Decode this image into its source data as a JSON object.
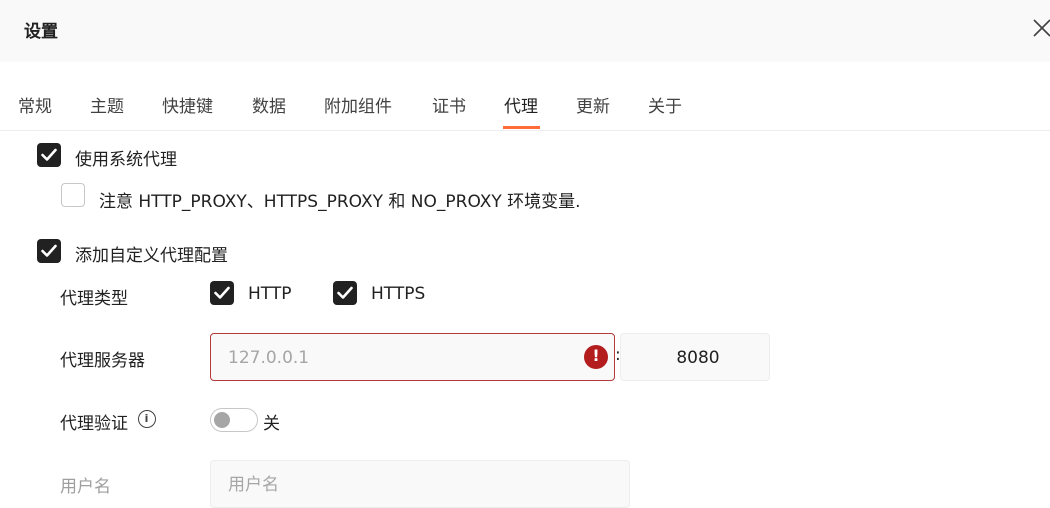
{
  "dialog": {
    "title": "设置"
  },
  "tabs": [
    {
      "label": "常规"
    },
    {
      "label": "主题"
    },
    {
      "label": "快捷键"
    },
    {
      "label": "数据"
    },
    {
      "label": "附加组件"
    },
    {
      "label": "证书"
    },
    {
      "label": "代理",
      "active": true
    },
    {
      "label": "更新"
    },
    {
      "label": "关于"
    }
  ],
  "proxy": {
    "use_system_proxy": {
      "label": "使用系统代理",
      "checked": true
    },
    "env_note": {
      "label": "注意 HTTP_PROXY、HTTPS_PROXY 和 NO_PROXY 环境变量.",
      "checked": false
    },
    "custom_proxy": {
      "label": "添加自定义代理配置",
      "checked": true
    },
    "proxy_type": {
      "label": "代理类型",
      "http": {
        "label": "HTTP",
        "checked": true
      },
      "https": {
        "label": "HTTPS",
        "checked": true
      }
    },
    "server": {
      "label": "代理服务器",
      "host_placeholder": "127.0.0.1",
      "host_value": "",
      "separator": ":",
      "port_value": "8080",
      "error_icon": "exclamation-circle-icon"
    },
    "auth": {
      "label": "代理验证",
      "toggle_state": "关",
      "enabled": false,
      "info_icon": "info-icon"
    },
    "username": {
      "label": "用户名",
      "placeholder": "用户名"
    }
  },
  "colors": {
    "accent": "#ff6c37",
    "error": "#b31d1d",
    "checkbox": "#212121"
  }
}
